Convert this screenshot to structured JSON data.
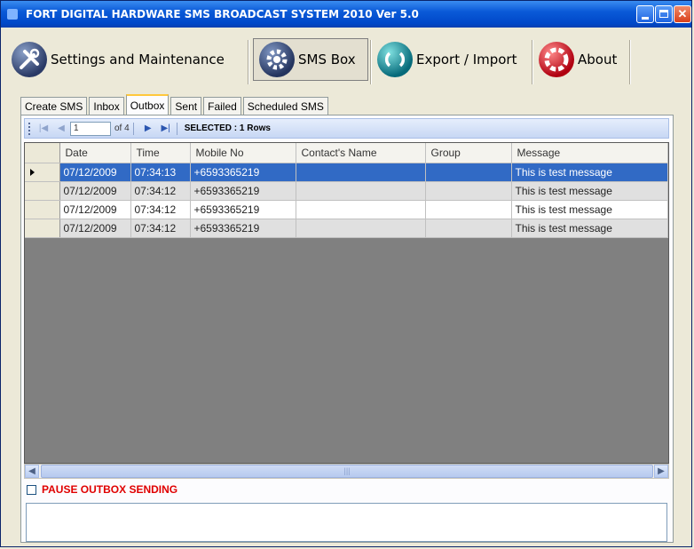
{
  "window": {
    "title": "FORT DIGITAL HARDWARE SMS BROADCAST SYSTEM 2010 Ver 5.0"
  },
  "toolbar": {
    "settings_label": "Settings and Maintenance",
    "smsbox_label": "SMS Box",
    "export_label": "Export / Import",
    "about_label": "About"
  },
  "tabs": [
    {
      "label": "Create SMS"
    },
    {
      "label": "Inbox"
    },
    {
      "label": "Outbox"
    },
    {
      "label": "Sent"
    },
    {
      "label": "Failed"
    },
    {
      "label": "Scheduled SMS"
    }
  ],
  "navigator": {
    "position": "1",
    "of_text": "of 4",
    "selected_text": "SELECTED : 1 Rows"
  },
  "grid": {
    "columns": [
      "Date",
      "Time",
      "Mobile No",
      "Contact's Name",
      "Group",
      "Message"
    ],
    "rows": [
      [
        "07/12/2009",
        "07:34:13",
        "+6593365219",
        "",
        "",
        "This is test message"
      ],
      [
        "07/12/2009",
        "07:34:12",
        "+6593365219",
        "",
        "",
        "This is test message"
      ],
      [
        "07/12/2009",
        "07:34:12",
        "+6593365219",
        "",
        "",
        "This is test message"
      ],
      [
        "07/12/2009",
        "07:34:12",
        "+6593365219",
        "",
        "",
        "This is test message"
      ]
    ]
  },
  "pause": {
    "label": "PAUSE OUTBOX SENDING",
    "checked": false
  },
  "colors": {
    "title_bar": "#0a5ad8",
    "selection": "#316ac5",
    "pause_text": "#e00000"
  }
}
